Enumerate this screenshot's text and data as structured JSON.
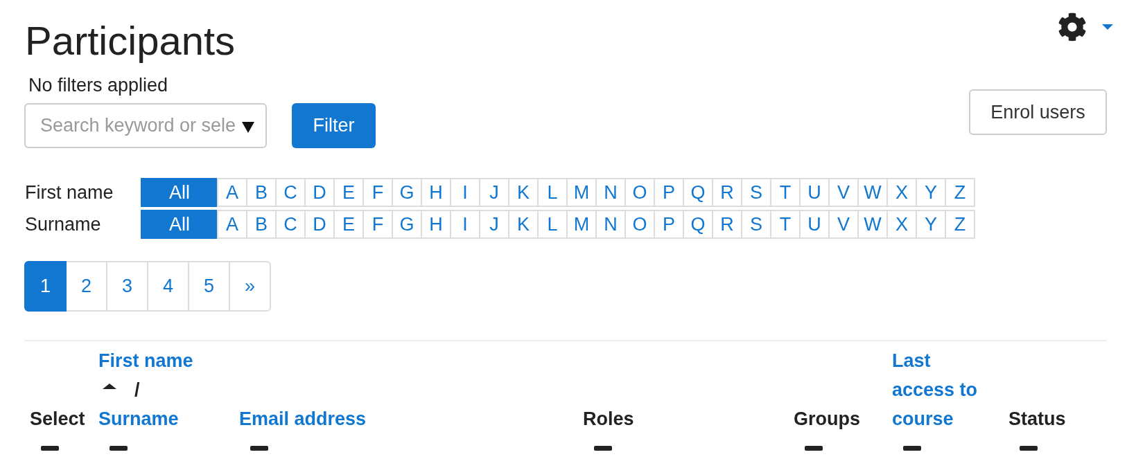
{
  "page": {
    "title": "Participants"
  },
  "filter": {
    "status": "No filters applied",
    "search": {
      "placeholder": "Search keyword or sele"
    },
    "button": "Filter"
  },
  "enrol_button": "Enrol users",
  "initials_bars": [
    {
      "label": "First name",
      "items": [
        {
          "label": "All",
          "selected": true
        },
        {
          "label": "A",
          "selected": false
        },
        {
          "label": "B",
          "selected": false
        },
        {
          "label": "C",
          "selected": false
        },
        {
          "label": "D",
          "selected": false
        },
        {
          "label": "E",
          "selected": false
        },
        {
          "label": "F",
          "selected": false
        },
        {
          "label": "G",
          "selected": false
        },
        {
          "label": "H",
          "selected": false
        },
        {
          "label": "I",
          "selected": false
        },
        {
          "label": "J",
          "selected": false
        },
        {
          "label": "K",
          "selected": false
        },
        {
          "label": "L",
          "selected": false
        },
        {
          "label": "M",
          "selected": false
        },
        {
          "label": "N",
          "selected": false
        },
        {
          "label": "O",
          "selected": false
        },
        {
          "label": "P",
          "selected": false
        },
        {
          "label": "Q",
          "selected": false
        },
        {
          "label": "R",
          "selected": false
        },
        {
          "label": "S",
          "selected": false
        },
        {
          "label": "T",
          "selected": false
        },
        {
          "label": "U",
          "selected": false
        },
        {
          "label": "V",
          "selected": false
        },
        {
          "label": "W",
          "selected": false
        },
        {
          "label": "X",
          "selected": false
        },
        {
          "label": "Y",
          "selected": false
        },
        {
          "label": "Z",
          "selected": false
        }
      ]
    },
    {
      "label": "Surname",
      "items": [
        {
          "label": "All",
          "selected": true
        },
        {
          "label": "A",
          "selected": false
        },
        {
          "label": "B",
          "selected": false
        },
        {
          "label": "C",
          "selected": false
        },
        {
          "label": "D",
          "selected": false
        },
        {
          "label": "E",
          "selected": false
        },
        {
          "label": "F",
          "selected": false
        },
        {
          "label": "G",
          "selected": false
        },
        {
          "label": "H",
          "selected": false
        },
        {
          "label": "I",
          "selected": false
        },
        {
          "label": "J",
          "selected": false
        },
        {
          "label": "K",
          "selected": false
        },
        {
          "label": "L",
          "selected": false
        },
        {
          "label": "M",
          "selected": false
        },
        {
          "label": "N",
          "selected": false
        },
        {
          "label": "O",
          "selected": false
        },
        {
          "label": "P",
          "selected": false
        },
        {
          "label": "Q",
          "selected": false
        },
        {
          "label": "R",
          "selected": false
        },
        {
          "label": "S",
          "selected": false
        },
        {
          "label": "T",
          "selected": false
        },
        {
          "label": "U",
          "selected": false
        },
        {
          "label": "V",
          "selected": false
        },
        {
          "label": "W",
          "selected": false
        },
        {
          "label": "X",
          "selected": false
        },
        {
          "label": "Y",
          "selected": false
        },
        {
          "label": "Z",
          "selected": false
        }
      ]
    }
  ],
  "pagination": [
    {
      "label": "1",
      "selected": true
    },
    {
      "label": "2",
      "selected": false
    },
    {
      "label": "3",
      "selected": false
    },
    {
      "label": "4",
      "selected": false
    },
    {
      "label": "5",
      "selected": false
    },
    {
      "label": "»",
      "selected": false
    }
  ],
  "table": {
    "columns": [
      {
        "kind": "text",
        "label": "Select"
      },
      {
        "kind": "name_pair",
        "first": {
          "label": "First name",
          "sorted_ascending": true
        },
        "separator": "/",
        "second": {
          "label": "Surname"
        }
      },
      {
        "kind": "link",
        "label": "Email address"
      },
      {
        "kind": "text",
        "label": "Roles"
      },
      {
        "kind": "text",
        "label": "Groups"
      },
      {
        "kind": "link",
        "label": "Last access to course"
      },
      {
        "kind": "text",
        "label": "Status"
      }
    ]
  }
}
